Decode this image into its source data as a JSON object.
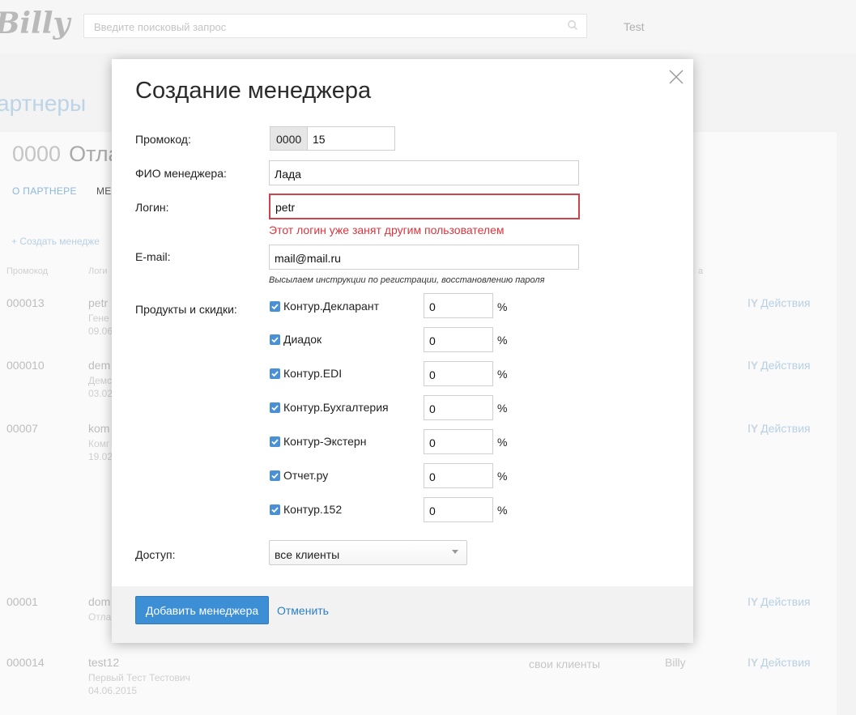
{
  "app": {
    "logo": "Billy",
    "user": "Test"
  },
  "search": {
    "placeholder": "Введите поисковый запрос"
  },
  "background": {
    "page_title": "артнеры",
    "partner_code": "0000",
    "partner_name": "Отла",
    "tabs": [
      {
        "label": "О ПАРТНЕРЕ",
        "color": "#8cb8dc"
      },
      {
        "label": "МЕ",
        "color": "#555555"
      }
    ],
    "create_link": "+ Создать менедже",
    "columns": {
      "code": "Промокод",
      "login": "Логи",
      "partial": "а"
    },
    "rows": [
      {
        "code": "000013",
        "login": "petr",
        "line1": "Гене",
        "line2": "09.06",
        "access": "",
        "owner": "",
        "action": "Действия"
      },
      {
        "code": "000010",
        "login": "dem",
        "line1": "Демс",
        "line2": "03.02",
        "access": "",
        "owner": "",
        "action": "Действия"
      },
      {
        "code": "00007",
        "login": "kom",
        "line1": "Комг",
        "line2": "19.02",
        "access": "",
        "owner": "",
        "action": "Действия"
      },
      {
        "code": "00001",
        "login": "dom",
        "line1": "Отла",
        "line2": "",
        "access": "",
        "owner": "",
        "action": "Действия"
      },
      {
        "code": "000014",
        "login": "test12",
        "line1": "Первый Тест Тестович",
        "line2": "04.06.2015",
        "access": "свои клиенты",
        "owner": "Billy",
        "action": "Действия"
      }
    ]
  },
  "modal": {
    "title": "Создание менеджера",
    "promo": {
      "label": "Промокод:",
      "prefix": "0000",
      "value": "15"
    },
    "fio": {
      "label": "ФИО менеджера:",
      "value": "Лада"
    },
    "login": {
      "label": "Логин:",
      "value": "petr",
      "error": "Этот логин уже занят другим пользователем"
    },
    "email": {
      "label": "E-mail:",
      "value": "mail@mail.ru",
      "hint": "Высылаем инструкции по регистрации, восстановлению пароля"
    },
    "products": {
      "label": "Продукты и скидки:",
      "percent_sign": "%",
      "items": [
        {
          "name": "Контур.Декларант",
          "checked": true,
          "discount": "0"
        },
        {
          "name": "Диадок",
          "checked": true,
          "discount": "0"
        },
        {
          "name": "Контур.EDI",
          "checked": true,
          "discount": "0"
        },
        {
          "name": "Контур.Бухгалтерия",
          "checked": true,
          "discount": "0"
        },
        {
          "name": "Контур-Экстерн",
          "checked": true,
          "discount": "0"
        },
        {
          "name": "Отчет.ру",
          "checked": true,
          "discount": "0"
        },
        {
          "name": "Контур.152",
          "checked": true,
          "discount": "0"
        }
      ]
    },
    "access": {
      "label": "Доступ:",
      "value": "все клиенты"
    },
    "submit_label": "Добавить менеджера",
    "cancel_label": "Отменить"
  },
  "colors": {
    "accent": "#3c8fd4",
    "error": "#d9353d",
    "checkbox": "#4a90d6"
  },
  "icons": {
    "close": "close-icon",
    "search": "search-icon",
    "dropdown": "chevron-down-icon",
    "actions": "tools-icon"
  }
}
